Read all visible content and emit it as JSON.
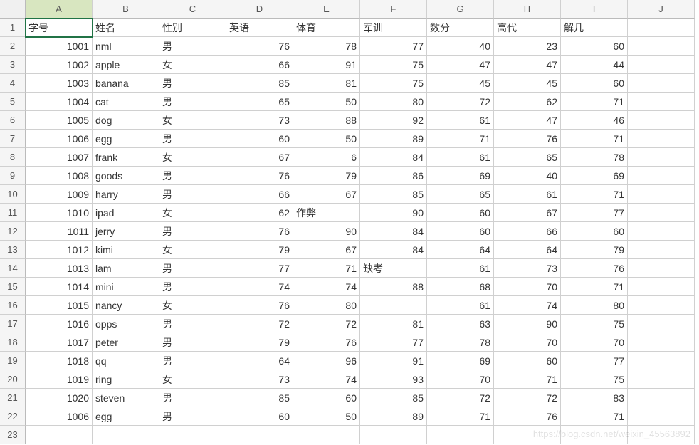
{
  "columns": [
    "A",
    "B",
    "C",
    "D",
    "E",
    "F",
    "G",
    "H",
    "I",
    "J"
  ],
  "row_numbers": [
    1,
    2,
    3,
    4,
    5,
    6,
    7,
    8,
    9,
    10,
    11,
    12,
    13,
    14,
    15,
    16,
    17,
    18,
    19,
    20,
    21,
    22,
    23
  ],
  "selected_column": "A",
  "active_cell": {
    "col": "A",
    "row": 1
  },
  "headers": {
    "A": "学号",
    "B": "姓名",
    "C": "性别",
    "D": "英语",
    "E": "体育",
    "F": "军训",
    "G": "数分",
    "H": "高代",
    "I": "解几"
  },
  "rows": [
    {
      "A": "1001",
      "B": "nml",
      "C": "男",
      "D": "76",
      "E": "78",
      "F": "77",
      "G": "40",
      "H": "23",
      "I": "60"
    },
    {
      "A": "1002",
      "B": "apple",
      "C": "女",
      "D": "66",
      "E": "91",
      "F": "75",
      "G": "47",
      "H": "47",
      "I": "44"
    },
    {
      "A": "1003",
      "B": "banana",
      "C": "男",
      "D": "85",
      "E": "81",
      "F": "75",
      "G": "45",
      "H": "45",
      "I": "60"
    },
    {
      "A": "1004",
      "B": "cat",
      "C": "男",
      "D": "65",
      "E": "50",
      "F": "80",
      "G": "72",
      "H": "62",
      "I": "71"
    },
    {
      "A": "1005",
      "B": "dog",
      "C": "女",
      "D": "73",
      "E": "88",
      "F": "92",
      "G": "61",
      "H": "47",
      "I": "46"
    },
    {
      "A": "1006",
      "B": "egg",
      "C": "男",
      "D": "60",
      "E": "50",
      "F": "89",
      "G": "71",
      "H": "76",
      "I": "71"
    },
    {
      "A": "1007",
      "B": "frank",
      "C": "女",
      "D": "67",
      "E": "6",
      "F": "84",
      "G": "61",
      "H": "65",
      "I": "78"
    },
    {
      "A": "1008",
      "B": "goods",
      "C": "男",
      "D": "76",
      "E": "79",
      "F": "86",
      "G": "69",
      "H": "40",
      "I": "69"
    },
    {
      "A": "1009",
      "B": "harry",
      "C": "男",
      "D": "66",
      "E": "67",
      "F": "85",
      "G": "65",
      "H": "61",
      "I": "71"
    },
    {
      "A": "1010",
      "B": "ipad",
      "C": "女",
      "D": "62",
      "E": "作弊",
      "F": "90",
      "G": "60",
      "H": "67",
      "I": "77"
    },
    {
      "A": "1011",
      "B": "jerry",
      "C": "男",
      "D": "76",
      "E": "90",
      "F": "84",
      "G": "60",
      "H": "66",
      "I": "60"
    },
    {
      "A": "1012",
      "B": "kimi",
      "C": "女",
      "D": "79",
      "E": "67",
      "F": "84",
      "G": "64",
      "H": "64",
      "I": "79"
    },
    {
      "A": "1013",
      "B": "lam",
      "C": "男",
      "D": "77",
      "E": "71",
      "F": "缺考",
      "G": "61",
      "H": "73",
      "I": "76"
    },
    {
      "A": "1014",
      "B": "mini",
      "C": "男",
      "D": "74",
      "E": "74",
      "F": "88",
      "G": "68",
      "H": "70",
      "I": "71"
    },
    {
      "A": "1015",
      "B": "nancy",
      "C": "女",
      "D": "76",
      "E": "80",
      "F": "",
      "G": "61",
      "H": "74",
      "I": "80"
    },
    {
      "A": "1016",
      "B": "opps",
      "C": "男",
      "D": "72",
      "E": "72",
      "F": "81",
      "G": "63",
      "H": "90",
      "I": "75"
    },
    {
      "A": "1017",
      "B": "peter",
      "C": "男",
      "D": "79",
      "E": "76",
      "F": "77",
      "G": "78",
      "H": "70",
      "I": "70"
    },
    {
      "A": "1018",
      "B": "qq",
      "C": "男",
      "D": "64",
      "E": "96",
      "F": "91",
      "G": "69",
      "H": "60",
      "I": "77"
    },
    {
      "A": "1019",
      "B": "ring",
      "C": "女",
      "D": "73",
      "E": "74",
      "F": "93",
      "G": "70",
      "H": "71",
      "I": "75"
    },
    {
      "A": "1020",
      "B": "steven",
      "C": "男",
      "D": "85",
      "E": "60",
      "F": "85",
      "G": "72",
      "H": "72",
      "I": "83"
    },
    {
      "A": "1006",
      "B": "egg",
      "C": "男",
      "D": "60",
      "E": "50",
      "F": "89",
      "G": "71",
      "H": "76",
      "I": "71"
    }
  ],
  "text_columns": [
    "B",
    "C"
  ],
  "numeric_columns": [
    "A",
    "D",
    "E",
    "F",
    "G",
    "H",
    "I"
  ],
  "non_numeric_overrides": {
    "10": {
      "E": true
    },
    "13": {
      "F": true
    }
  },
  "watermark": "https://blog.csdn.net/weixin_45563892"
}
